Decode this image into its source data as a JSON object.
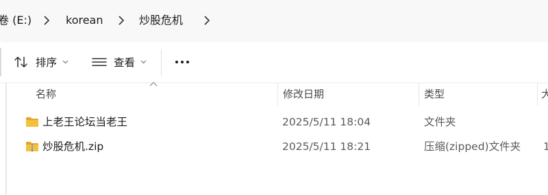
{
  "address_bar": {
    "crumbs": [
      "卷 (E:)",
      "korean",
      "炒股危机"
    ]
  },
  "toolbar": {
    "sort_label": "排序",
    "view_label": "查看",
    "more_label": "•••"
  },
  "columns": {
    "name": "名称",
    "modified": "修改日期",
    "type": "类型",
    "size": "大"
  },
  "files": [
    {
      "name": "上老王论坛当老王",
      "modified": "2025/5/11 18:04",
      "type": "文件夹",
      "size": "",
      "icon": "folder-icon"
    },
    {
      "name": "炒股危机.zip",
      "modified": "2025/5/11 18:21",
      "type": "压缩(zipped)文件夹",
      "size": "1",
      "icon": "zip-folder-icon"
    }
  ],
  "colors": {
    "folder_yellow": "#f3c13c",
    "folder_dark": "#e0a62b",
    "address_bg": "#f8f8f8"
  }
}
